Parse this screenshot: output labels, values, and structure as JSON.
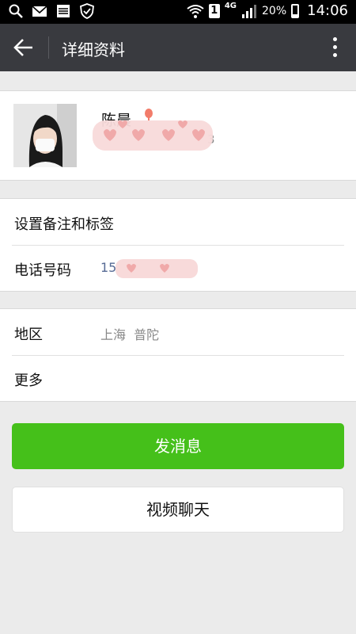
{
  "status_bar": {
    "sim_slot": "1",
    "network": "4G",
    "battery": "20%",
    "time": "14:06",
    "icons": [
      "search-icon",
      "mail-icon",
      "storage-icon",
      "shield-icon",
      "wifi-icon",
      "signal-icon",
      "battery-icon"
    ]
  },
  "header": {
    "title": "详细资料",
    "back_icon": "arrow-left-icon",
    "menu_icon": "more-vertical-icon"
  },
  "profile": {
    "name": "陈晨",
    "gender_icon": "female-icon",
    "wechat_id_masked": "3"
  },
  "rows_group1": [
    {
      "label": "设置备注和标签",
      "value": ""
    },
    {
      "label": "电话号码",
      "value": "15"
    }
  ],
  "rows_group2": [
    {
      "label": "地区",
      "value": "上海  普陀"
    },
    {
      "label": "更多",
      "value": ""
    }
  ],
  "buttons": {
    "send_message": "发消息",
    "video_chat": "视频聊天"
  },
  "colors": {
    "header_bg": "#393a3f",
    "primary_green": "#45c01a",
    "page_bg": "#ebebeb",
    "phone_link": "#576b95"
  }
}
